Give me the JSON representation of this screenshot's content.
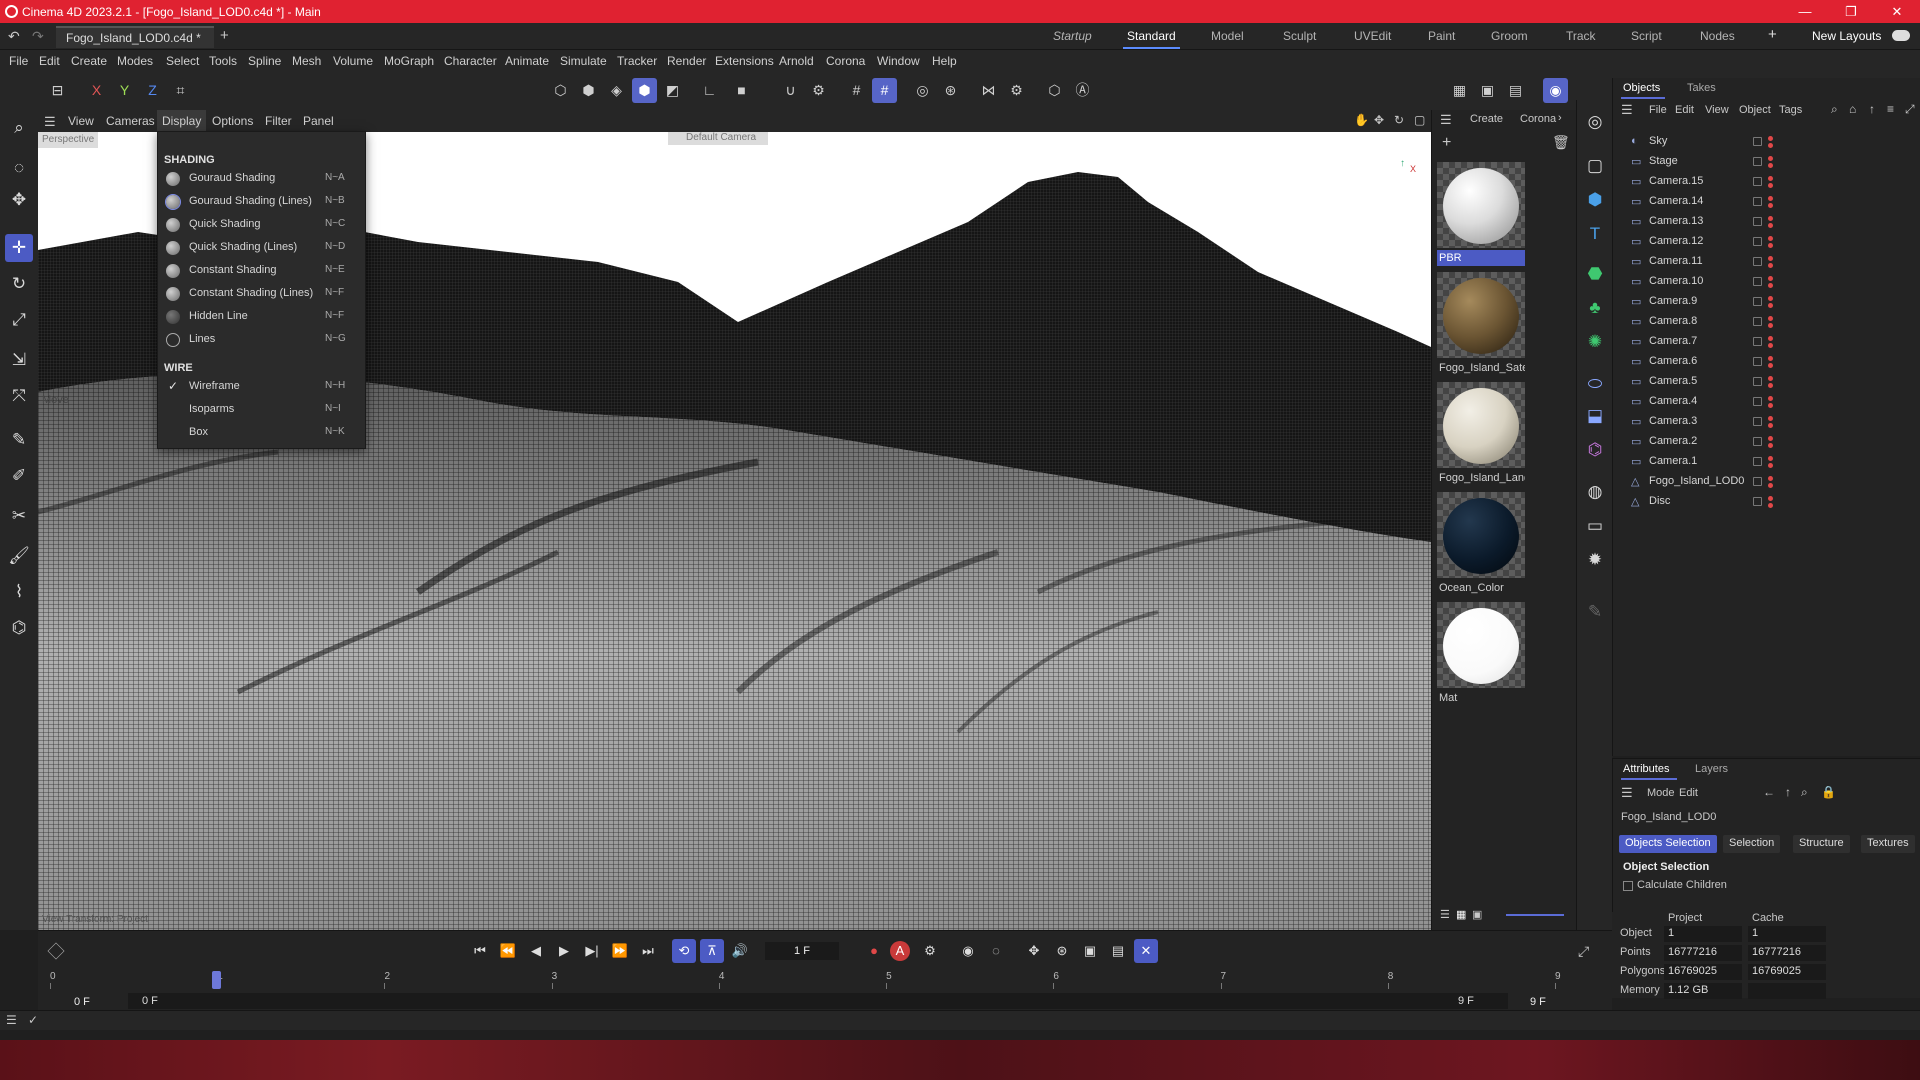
{
  "window": {
    "title": "Cinema 4D 2023.2.1 - [Fogo_Island_LOD0.c4d *] - Main",
    "doc_tab": "Fogo_Island_LOD0.c4d *",
    "new_layouts": "New Layouts"
  },
  "layouts": [
    "Startup",
    "Standard",
    "Model",
    "Sculpt",
    "UVEdit",
    "Paint",
    "Groom",
    "Track",
    "Script",
    "Nodes"
  ],
  "menubar": [
    "File",
    "Edit",
    "Create",
    "Modes",
    "Select",
    "Tools",
    "Spline",
    "Mesh",
    "Volume",
    "MoGraph",
    "Character",
    "Animate",
    "Simulate",
    "Tracker",
    "Render",
    "Extensions",
    "Arnold",
    "Corona",
    "Window",
    "Help"
  ],
  "viewport_menu": [
    "View",
    "Cameras",
    "Display",
    "Options",
    "Filter",
    "Panel"
  ],
  "axis_labels": {
    "x": "X",
    "y": "Y",
    "z": "Z"
  },
  "viewport": {
    "overlay_left": "Perspective",
    "overlay_center": "Default Camera",
    "move_label": "Move",
    "bottom_left": "View Transform: Project"
  },
  "display_menu": {
    "shading_header": "SHADING",
    "wire_header": "WIRE",
    "shading_items": [
      {
        "label": "Gouraud Shading",
        "shortcut": "N~A"
      },
      {
        "label": "Gouraud Shading (Lines)",
        "shortcut": "N~B"
      },
      {
        "label": "Quick Shading",
        "shortcut": "N~C"
      },
      {
        "label": "Quick Shading (Lines)",
        "shortcut": "N~D"
      },
      {
        "label": "Constant Shading",
        "shortcut": "N~E"
      },
      {
        "label": "Constant Shading (Lines)",
        "shortcut": "N~F"
      },
      {
        "label": "Hidden Line",
        "shortcut": "N~F"
      },
      {
        "label": "Lines",
        "shortcut": "N~G"
      }
    ],
    "wire_items": [
      {
        "label": "Wireframe",
        "shortcut": "N~H",
        "checked": true
      },
      {
        "label": "Isoparms",
        "shortcut": "N~I",
        "checked": false
      },
      {
        "label": "Box",
        "shortcut": "N~K",
        "checked": false
      }
    ]
  },
  "material_panel": {
    "menu": [
      "Create",
      "Corona"
    ],
    "materials": [
      {
        "name": "PBR",
        "selected": true,
        "color": "#e8e8e8"
      },
      {
        "name": "Fogo_Island_Satel",
        "selected": false,
        "color": "#6b5533"
      },
      {
        "name": "Fogo_Island_Land",
        "selected": false,
        "color": "#d8d2c2"
      },
      {
        "name": "Ocean_Color",
        "selected": false,
        "color": "#0b1a2a"
      },
      {
        "name": "Mat",
        "selected": false,
        "color": "#ffffff"
      }
    ]
  },
  "objects_panel": {
    "tabs": [
      "Objects",
      "Takes"
    ],
    "menu": [
      "File",
      "Edit",
      "View",
      "Object",
      "Tags"
    ],
    "items": [
      "Sky",
      "Stage",
      "Camera.15",
      "Camera.14",
      "Camera.13",
      "Camera.12",
      "Camera.11",
      "Camera.10",
      "Camera.9",
      "Camera.8",
      "Camera.7",
      "Camera.6",
      "Camera.5",
      "Camera.4",
      "Camera.3",
      "Camera.2",
      "Camera.1",
      "Fogo_Island_LOD0",
      "Disc"
    ]
  },
  "attributes_panel": {
    "tabs": [
      "Attributes",
      "Layers"
    ],
    "menu": [
      "Mode",
      "Edit"
    ],
    "object_name": "Fogo_Island_LOD0",
    "sub_tabs": [
      "Objects Selection",
      "Selection",
      "Structure",
      "Textures"
    ],
    "section": "Object Selection",
    "calc_children": "Calculate Children",
    "col_project": "Project",
    "col_cache": "Cache",
    "rows": [
      {
        "label": "Object",
        "project": "1",
        "cache": "1"
      },
      {
        "label": "Points",
        "project": "16777216",
        "cache": "16777216"
      },
      {
        "label": "Polygons",
        "project": "16769025",
        "cache": "16769025"
      },
      {
        "label": "Memory",
        "project": "1.12 GB",
        "cache": ""
      }
    ]
  },
  "timeline": {
    "current_frame": "1 F",
    "start_left": "0 F",
    "start_field": "0 F",
    "end_field": "9 F",
    "end_right": "9 F",
    "ticks": [
      "0",
      "1",
      "2",
      "3",
      "4",
      "5",
      "6",
      "7",
      "8",
      "9"
    ],
    "playhead_frame": 1,
    "total_frames": 9
  },
  "colors": {
    "title_bar": "#e02231",
    "accent": "#4c5bc4",
    "panel_bg": "#232323"
  }
}
